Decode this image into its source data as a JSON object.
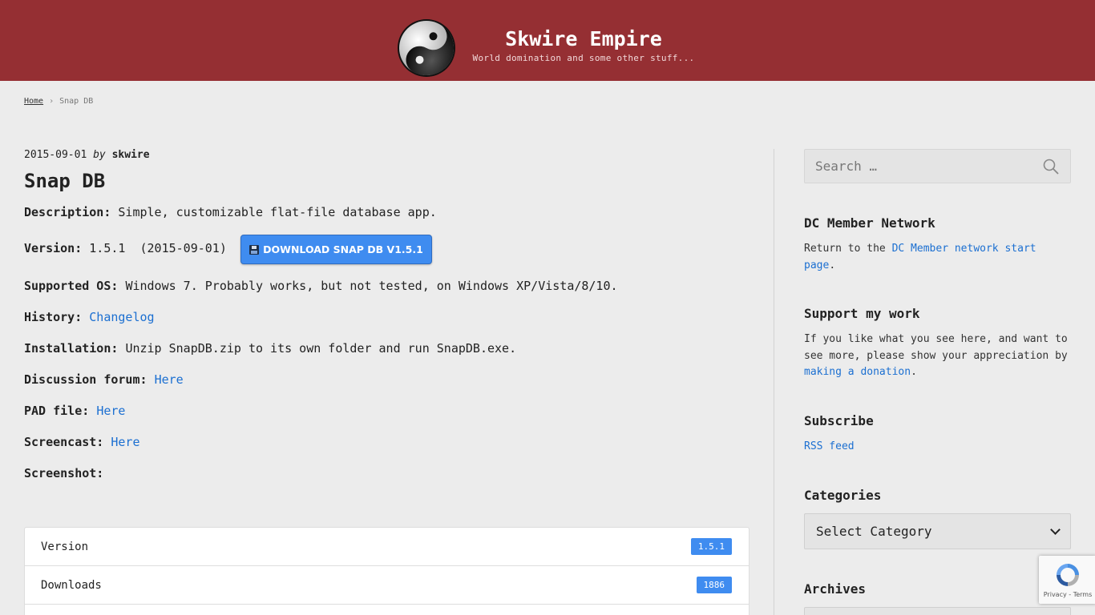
{
  "header": {
    "title": "Skwire Empire",
    "tagline": "World domination and some other stuff...",
    "logo_icon": "yin-yang-icon"
  },
  "breadcrumb": {
    "home": "Home",
    "separator": "›",
    "current": "Snap DB"
  },
  "post": {
    "date": "2015-09-01",
    "by": "by",
    "author": "skwire",
    "title": "Snap DB",
    "fields": {
      "description_label": "Description:",
      "description_value": "Simple, customizable flat-file database app.",
      "version_label": "Version:",
      "version_value": "1.5.1  (2015-09-01)",
      "download_label": "DOWNLOAD SNAP DB V1.5.1",
      "os_label": "Supported OS:",
      "os_value": "Windows 7. Probably works, but not tested, on Windows XP/Vista/8/10.",
      "history_label": "History:",
      "history_link": "Changelog",
      "install_label": "Installation:",
      "install_value": "Unzip SnapDB.zip to its own folder and run SnapDB.exe.",
      "forum_label": "Discussion forum:",
      "forum_link": "Here",
      "pad_label": "PAD file:",
      "pad_link": "Here",
      "screencast_label": "Screencast:",
      "screencast_link": "Here",
      "screenshot_label": "Screenshot:"
    },
    "info_table": [
      {
        "label": "Version",
        "badge": "1.5.1"
      },
      {
        "label": "Downloads",
        "badge": "1886"
      }
    ]
  },
  "sidebar": {
    "search_placeholder": "Search …",
    "dc_title": "DC Member Network",
    "dc_text_before": "Return to the ",
    "dc_link": "DC Member network start page",
    "dc_text_after": ".",
    "support_title": "Support my work",
    "support_text_before": "If you like what you see here, and want to see more, please show your appreciation by ",
    "support_link": "making a donation",
    "support_text_after": ".",
    "subscribe_title": "Subscribe",
    "rss_link": "RSS feed",
    "categories_title": "Categories",
    "categories_selected": "Select Category",
    "archives_title": "Archives"
  },
  "recaptcha": {
    "links": "Privacy - Terms"
  },
  "colors": {
    "header_bg": "#952f33",
    "accent": "#3f8cf0",
    "link": "#1b6fd1"
  }
}
